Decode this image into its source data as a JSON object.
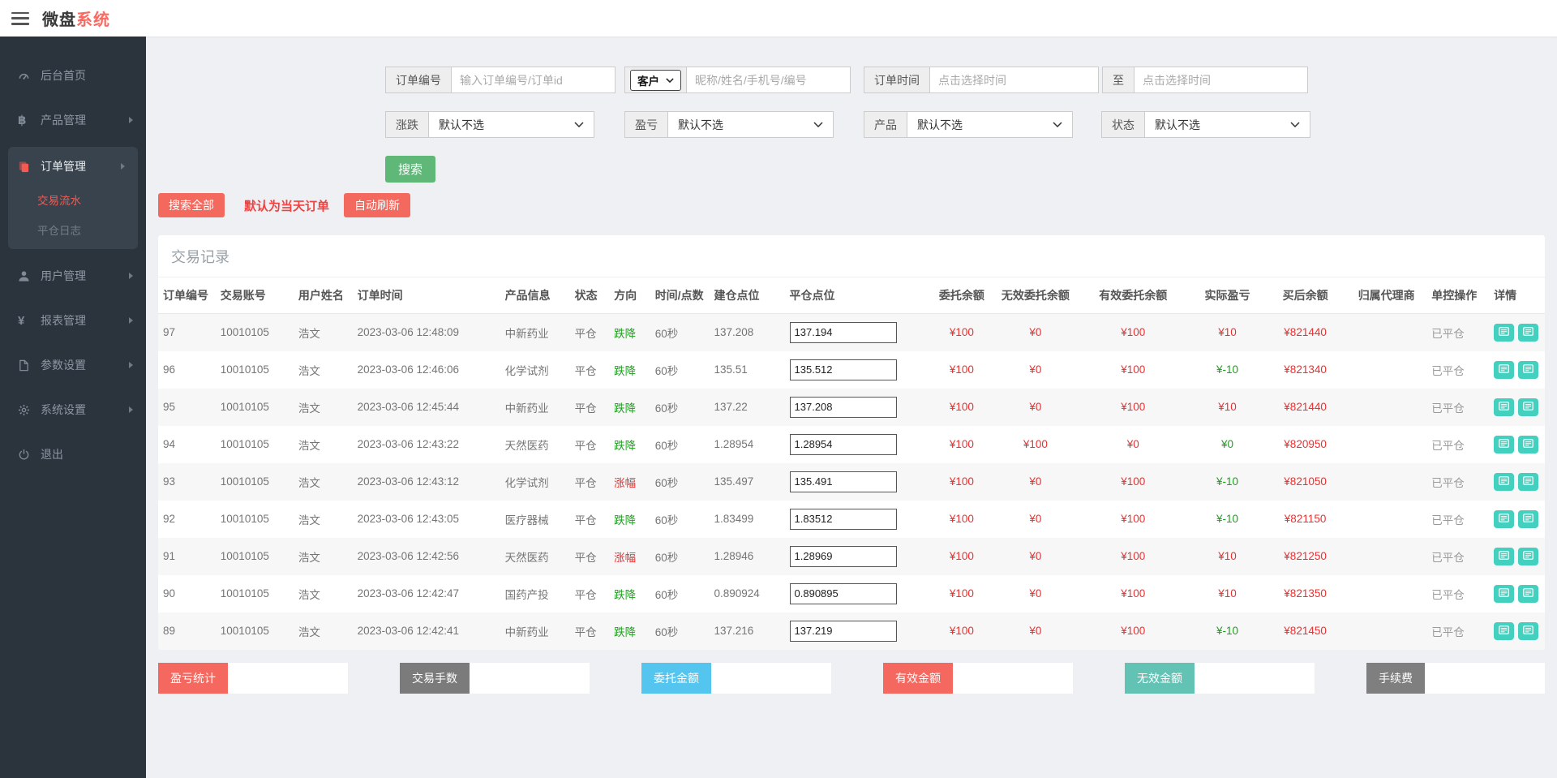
{
  "header": {
    "brand_primary": "微盘",
    "brand_accent": "系统"
  },
  "sidebar": {
    "items": [
      {
        "id": "dashboard",
        "label": "后台首页",
        "icon": "dashboard-icon",
        "arrow": false
      },
      {
        "id": "product",
        "label": "产品管理",
        "icon": "product-icon",
        "arrow": true
      },
      {
        "id": "order",
        "label": "订单管理",
        "icon": "order-icon",
        "arrow": true,
        "active": true,
        "children": [
          {
            "id": "trade-flow",
            "label": "交易流水",
            "active": true
          },
          {
            "id": "close-log",
            "label": "平仓日志",
            "active": false
          }
        ]
      },
      {
        "id": "user",
        "label": "用户管理",
        "icon": "user-icon",
        "arrow": true
      },
      {
        "id": "report",
        "label": "报表管理",
        "icon": "report-icon",
        "arrow": true
      },
      {
        "id": "params",
        "label": "参数设置",
        "icon": "params-icon",
        "arrow": true
      },
      {
        "id": "system",
        "label": "系统设置",
        "icon": "system-icon",
        "arrow": true
      },
      {
        "id": "logout",
        "label": "退出",
        "icon": "logout-icon",
        "arrow": false
      }
    ]
  },
  "filters": {
    "order_no_label": "订单编号",
    "order_no_placeholder": "输入订单编号/订单id",
    "customer_select_value": "客户",
    "customer_placeholder": "昵称/姓名/手机号/编号",
    "time_label": "订单时间",
    "time_start_placeholder": "点击选择时间",
    "to_label": "至",
    "time_end_placeholder": "点击选择时间",
    "updown_label": "涨跌",
    "updown_value": "默认不选",
    "pl_label": "盈亏",
    "pl_value": "默认不选",
    "product_label": "产品",
    "product_value": "默认不选",
    "status_label": "状态",
    "status_value": "默认不选",
    "search_button": "搜索"
  },
  "toolbar": {
    "search_all": "搜索全部",
    "note": "默认为当天订单",
    "auto_refresh": "自动刷新"
  },
  "table": {
    "title": "交易记录",
    "columns": [
      {
        "key": "order_no",
        "label": "订单编号"
      },
      {
        "key": "account",
        "label": "交易账号"
      },
      {
        "key": "name",
        "label": "用户姓名"
      },
      {
        "key": "time",
        "label": "订单时间"
      },
      {
        "key": "product",
        "label": "产品信息"
      },
      {
        "key": "status",
        "label": "状态"
      },
      {
        "key": "direction",
        "label": "方向"
      },
      {
        "key": "duration",
        "label": "时间/点数"
      },
      {
        "key": "open_point",
        "label": "建仓点位"
      },
      {
        "key": "close_point",
        "label": "平仓点位"
      },
      {
        "key": "entrust",
        "label": "委托余额"
      },
      {
        "key": "invalid_entrust",
        "label": "无效委托余额"
      },
      {
        "key": "valid_entrust",
        "label": "有效委托余额"
      },
      {
        "key": "profit",
        "label": "实际盈亏"
      },
      {
        "key": "balance",
        "label": "买后余额"
      },
      {
        "key": "agent",
        "label": "归属代理商"
      },
      {
        "key": "control",
        "label": "单控操作"
      },
      {
        "key": "detail",
        "label": "详情"
      }
    ],
    "rows": [
      {
        "order_no": "97",
        "account": "10010105",
        "name": "浩文",
        "time": "2023-03-06 12:48:09",
        "product": "中新药业",
        "status": "平仓",
        "direction": "跌降",
        "direction_type": "down",
        "duration": "60秒",
        "open_point": "137.208",
        "close_point": "137.194",
        "entrust": "¥100",
        "invalid_entrust": "¥0",
        "valid_entrust": "¥100",
        "profit": "¥10",
        "profit_type": "pos",
        "balance": "¥821440",
        "agent": "",
        "control": "已平仓"
      },
      {
        "order_no": "96",
        "account": "10010105",
        "name": "浩文",
        "time": "2023-03-06 12:46:06",
        "product": "化学试剂",
        "status": "平仓",
        "direction": "跌降",
        "direction_type": "down",
        "duration": "60秒",
        "open_point": "135.51",
        "close_point": "135.512",
        "entrust": "¥100",
        "invalid_entrust": "¥0",
        "valid_entrust": "¥100",
        "profit": "¥-10",
        "profit_type": "neg",
        "balance": "¥821340",
        "agent": "",
        "control": "已平仓"
      },
      {
        "order_no": "95",
        "account": "10010105",
        "name": "浩文",
        "time": "2023-03-06 12:45:44",
        "product": "中新药业",
        "status": "平仓",
        "direction": "跌降",
        "direction_type": "down",
        "duration": "60秒",
        "open_point": "137.22",
        "close_point": "137.208",
        "entrust": "¥100",
        "invalid_entrust": "¥0",
        "valid_entrust": "¥100",
        "profit": "¥10",
        "profit_type": "pos",
        "balance": "¥821440",
        "agent": "",
        "control": "已平仓"
      },
      {
        "order_no": "94",
        "account": "10010105",
        "name": "浩文",
        "time": "2023-03-06 12:43:22",
        "product": "天然医药",
        "status": "平仓",
        "direction": "跌降",
        "direction_type": "down",
        "duration": "60秒",
        "open_point": "1.28954",
        "close_point": "1.28954",
        "entrust": "¥100",
        "invalid_entrust": "¥100",
        "valid_entrust": "¥0",
        "profit": "¥0",
        "profit_type": "neg",
        "balance": "¥820950",
        "agent": "",
        "control": "已平仓"
      },
      {
        "order_no": "93",
        "account": "10010105",
        "name": "浩文",
        "time": "2023-03-06 12:43:12",
        "product": "化学试剂",
        "status": "平仓",
        "direction": "涨幅",
        "direction_type": "up",
        "duration": "60秒",
        "open_point": "135.497",
        "close_point": "135.491",
        "entrust": "¥100",
        "invalid_entrust": "¥0",
        "valid_entrust": "¥100",
        "profit": "¥-10",
        "profit_type": "neg",
        "balance": "¥821050",
        "agent": "",
        "control": "已平仓"
      },
      {
        "order_no": "92",
        "account": "10010105",
        "name": "浩文",
        "time": "2023-03-06 12:43:05",
        "product": "医疗器械",
        "status": "平仓",
        "direction": "跌降",
        "direction_type": "down",
        "duration": "60秒",
        "open_point": "1.83499",
        "close_point": "1.83512",
        "entrust": "¥100",
        "invalid_entrust": "¥0",
        "valid_entrust": "¥100",
        "profit": "¥-10",
        "profit_type": "neg",
        "balance": "¥821150",
        "agent": "",
        "control": "已平仓"
      },
      {
        "order_no": "91",
        "account": "10010105",
        "name": "浩文",
        "time": "2023-03-06 12:42:56",
        "product": "天然医药",
        "status": "平仓",
        "direction": "涨幅",
        "direction_type": "up",
        "duration": "60秒",
        "open_point": "1.28946",
        "close_point": "1.28969",
        "entrust": "¥100",
        "invalid_entrust": "¥0",
        "valid_entrust": "¥100",
        "profit": "¥10",
        "profit_type": "pos",
        "balance": "¥821250",
        "agent": "",
        "control": "已平仓"
      },
      {
        "order_no": "90",
        "account": "10010105",
        "name": "浩文",
        "time": "2023-03-06 12:42:47",
        "product": "国药产投",
        "status": "平仓",
        "direction": "跌降",
        "direction_type": "down",
        "duration": "60秒",
        "open_point": "0.890924",
        "close_point": "0.890895",
        "entrust": "¥100",
        "invalid_entrust": "¥0",
        "valid_entrust": "¥100",
        "profit": "¥10",
        "profit_type": "pos",
        "balance": "¥821350",
        "agent": "",
        "control": "已平仓"
      },
      {
        "order_no": "89",
        "account": "10010105",
        "name": "浩文",
        "time": "2023-03-06 12:42:41",
        "product": "中新药业",
        "status": "平仓",
        "direction": "跌降",
        "direction_type": "down",
        "duration": "60秒",
        "open_point": "137.216",
        "close_point": "137.219",
        "entrust": "¥100",
        "invalid_entrust": "¥0",
        "valid_entrust": "¥100",
        "profit": "¥-10",
        "profit_type": "neg",
        "balance": "¥821450",
        "agent": "",
        "control": "已平仓"
      }
    ]
  },
  "summary": [
    {
      "id": "profit-total",
      "label": "盈亏统计",
      "color": "#f4685f",
      "value": ""
    },
    {
      "id": "trade-lots",
      "label": "交易手数",
      "color": "#7b7b7b",
      "value": ""
    },
    {
      "id": "entrust-total",
      "label": "委托金额",
      "color": "#54c5ef",
      "value": ""
    },
    {
      "id": "valid-total",
      "label": "有效金额",
      "color": "#f4685f",
      "value": ""
    },
    {
      "id": "invalid-total",
      "label": "无效金额",
      "color": "#62c3b5",
      "value": ""
    },
    {
      "id": "fee-total",
      "label": "手续费",
      "color": "#7f7f7f",
      "value": ""
    }
  ],
  "colors": {
    "accent_red": "#f4695e",
    "green_button": "#5fb878",
    "teal_icon": "#43d0bf",
    "money_red": "#ee2f2f",
    "money_green": "#1ca01c",
    "sidebar_bg": "#2b343d"
  }
}
